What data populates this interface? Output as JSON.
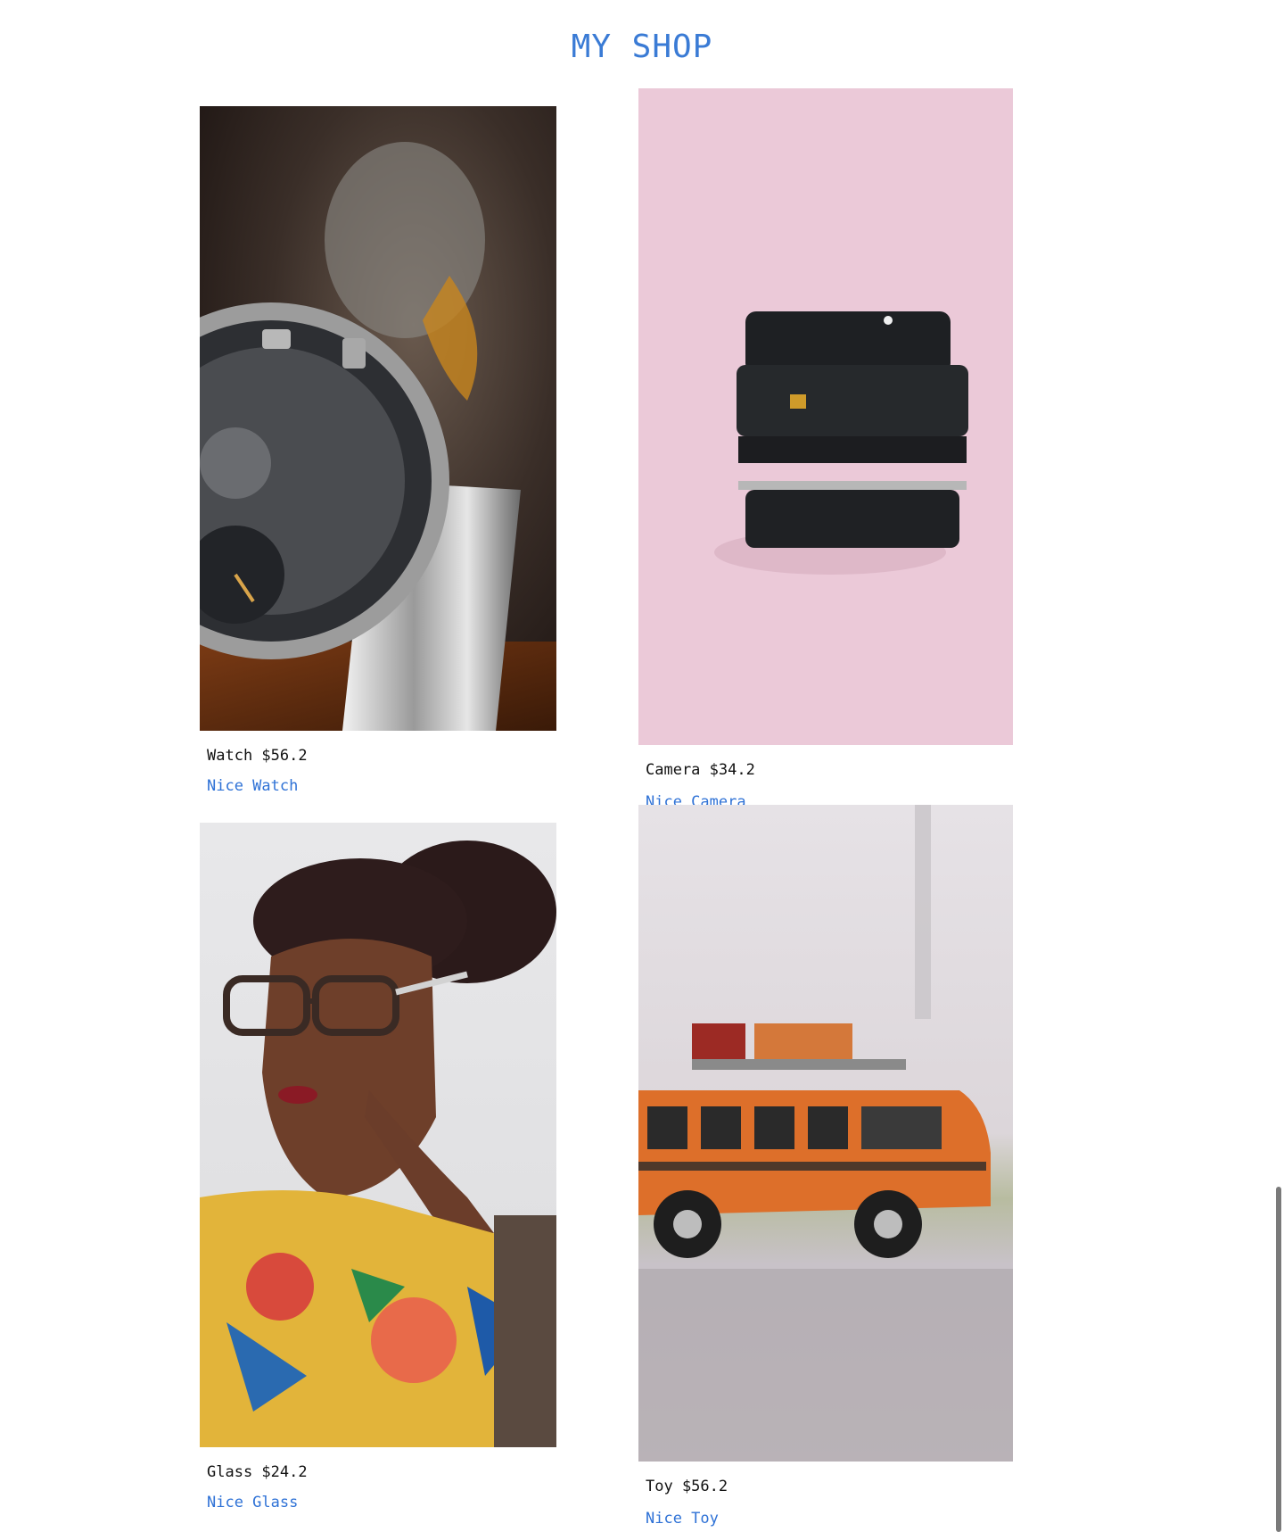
{
  "header": {
    "title": "MY SHOP"
  },
  "products": [
    {
      "name": "Watch",
      "price_text": "Watch $56.2",
      "description": "Nice Watch"
    },
    {
      "name": "Camera",
      "price_text": "Camera $34.2",
      "description": "Nice Camera"
    },
    {
      "name": "Glass",
      "price_text": "Glass $24.2",
      "description": "Nice Glass"
    },
    {
      "name": "Toy",
      "price_text": "Toy $56.2",
      "description": "Nice Toy"
    }
  ]
}
